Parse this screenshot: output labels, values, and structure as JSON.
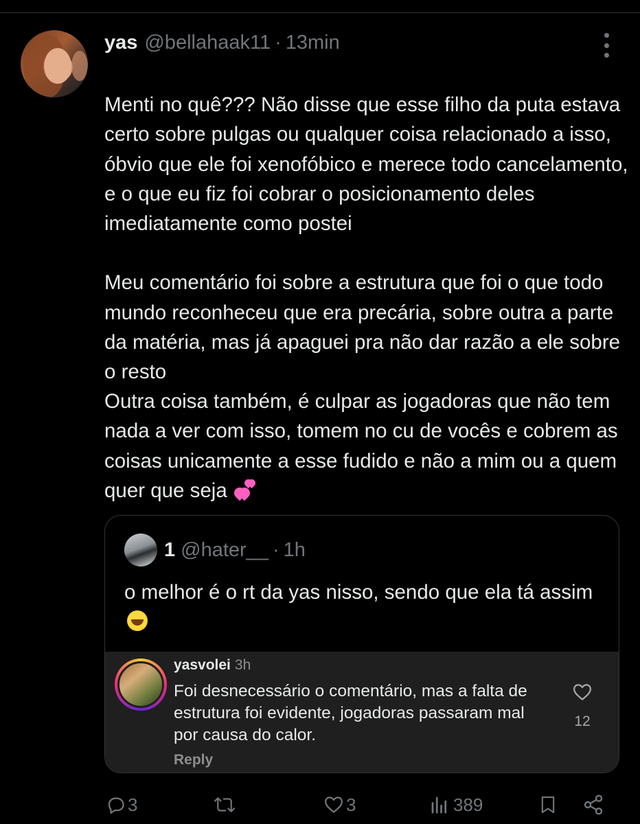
{
  "tweet": {
    "display_name": "yas",
    "handle": "@bellahaak11",
    "separator": "·",
    "time": "13min",
    "paragraphs": [
      "Menti no quê??? Não disse que esse filho da puta estava certo sobre pulgas ou qualquer coisa relacionado a isso, óbvio que ele foi xenofóbico e merece todo cancelamento, e o que eu fiz foi cobrar o posicionamento deles imediatamente como postei",
      "Meu comentário foi sobre a estrutura que foi o que todo mundo reconheceu que era precária, sobre outra a parte da matéria, mas já apaguei pra não dar razão a ele sobre o resto",
      "Outra coisa também, é culpar as jogadoras que não tem nada a ver com isso, tomem no cu de vocês e cobrem as coisas unicamente a esse fudido e não a mim ou a quem quer que seja"
    ],
    "paragraph3_emoji": "two-hearts-emoji"
  },
  "quote": {
    "display_name": "1",
    "handle": "@hater__",
    "separator": "·",
    "time": "1h",
    "text": "o melhor é o rt da yas nisso, sendo que ela tá assim",
    "emoji": "rofl-emoji",
    "instagram": {
      "username": "yasvolei",
      "time": "3h",
      "comment": "Foi desnecessário o comentário, mas a falta de estrutura foi evidente, jogadoras passaram mal por causa do calor.",
      "likes": "12",
      "reply_label": "Reply"
    }
  },
  "actions": {
    "replies": "3",
    "retweets": "",
    "likes": "3",
    "views": "389"
  },
  "colors": {
    "background": "#000000",
    "text": "#e7e9ea",
    "muted": "#71767b",
    "border": "#2f3336",
    "insta_panel": "#1f1f1f",
    "hearts_emoji": "#ff5fc1"
  }
}
